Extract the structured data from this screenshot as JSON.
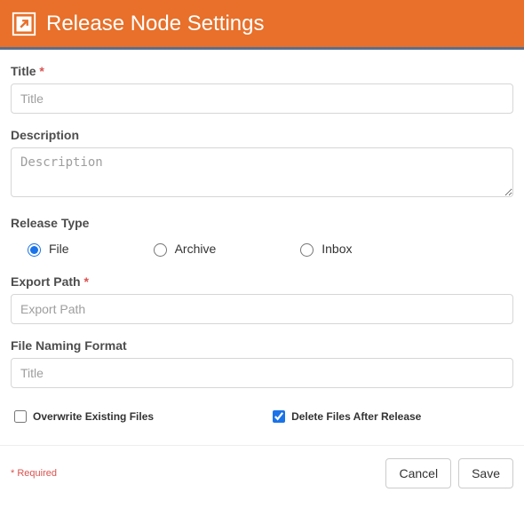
{
  "header": {
    "title": "Release Node Settings"
  },
  "labels": {
    "title": "Title",
    "description": "Description",
    "release_type": "Release Type",
    "export_path": "Export Path",
    "file_naming": "File Naming Format"
  },
  "required_marker": "*",
  "placeholders": {
    "title": "Title",
    "description": "Description",
    "export_path": "Export Path",
    "file_naming": "Title"
  },
  "values": {
    "title": "",
    "description": "",
    "export_path": "",
    "file_naming": ""
  },
  "release_type": {
    "options": {
      "file": "File",
      "archive": "Archive",
      "inbox": "Inbox"
    },
    "selected": "file"
  },
  "checkboxes": {
    "overwrite": {
      "label": "Overwrite Existing Files",
      "checked": false
    },
    "delete_after": {
      "label": "Delete Files After Release",
      "checked": true
    }
  },
  "footer": {
    "required_note": "* Required",
    "cancel": "Cancel",
    "save": "Save"
  }
}
